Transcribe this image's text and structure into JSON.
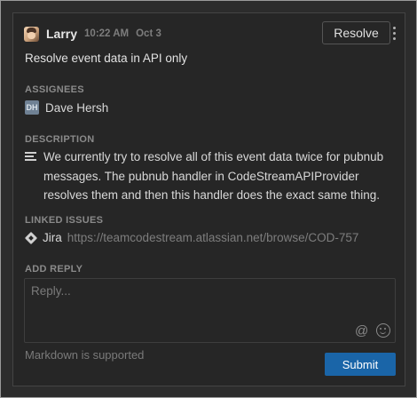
{
  "comment": {
    "author": "Larry",
    "timestamp": "10:22 AM",
    "date": "Oct 3",
    "resolve_label": "Resolve",
    "title": "Resolve event data in API only"
  },
  "assignees": {
    "heading": "ASSIGNEES",
    "items": [
      {
        "initials": "DH",
        "name": "Dave Hersh"
      }
    ]
  },
  "description": {
    "heading": "DESCRIPTION",
    "text": "We currently try to resolve all of this event data twice for pubnub messages. The pubnub handler in CodeStreamAPIProvider resolves them and then this handler does the exact same thing."
  },
  "linked_issues": {
    "heading": "LINKED ISSUES",
    "provider": "Jira",
    "url": "https://teamcodestream.atlassian.net/browse/COD-757"
  },
  "reply": {
    "heading": "ADD REPLY",
    "placeholder": "Reply...",
    "markdown_note": "Markdown is supported",
    "submit_label": "Submit"
  },
  "icons": {
    "avatar": "user-avatar-photo",
    "menu": "kebab-menu-icon",
    "description": "align-left-icon",
    "jira": "jira-diamond-icon",
    "mention": "at-icon",
    "emoji": "smiley-icon"
  },
  "colors": {
    "background": "#262626",
    "submit": "#1a65a8",
    "muted_text": "#7d7d7d",
    "heading_text": "#8a8a8a"
  }
}
